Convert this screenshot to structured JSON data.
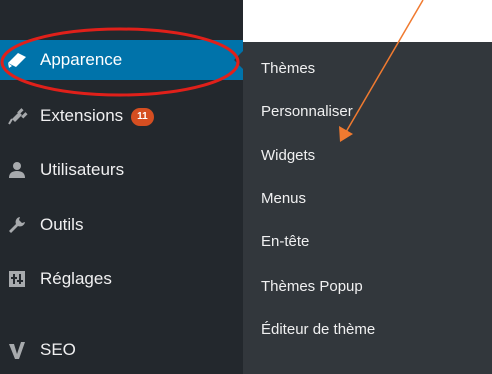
{
  "sidebar": {
    "items": [
      {
        "label": "Apparence",
        "icon": "paint-brush-icon",
        "active": true
      },
      {
        "label": "Extensions",
        "icon": "plugin-icon",
        "badge": "11"
      },
      {
        "label": "Utilisateurs",
        "icon": "users-icon"
      },
      {
        "label": "Outils",
        "icon": "wrench-icon"
      },
      {
        "label": "Réglages",
        "icon": "settings-icon"
      },
      {
        "label": "SEO",
        "icon": "seo-icon"
      }
    ]
  },
  "submenu": {
    "items": [
      {
        "label": "Thèmes"
      },
      {
        "label": "Personnaliser"
      },
      {
        "label": "Widgets"
      },
      {
        "label": "Menus"
      },
      {
        "label": "En-tête"
      },
      {
        "label": "Thèmes Popup"
      },
      {
        "label": "Éditeur de thème"
      }
    ]
  },
  "annotations": {
    "highlight": "red-ellipse-around-apparence",
    "arrow": "orange-arrow-pointing-to-widgets"
  },
  "colors": {
    "sidebar_bg": "#23282d",
    "submenu_bg": "#32373c",
    "active_bg": "#0073aa",
    "badge": "#d54e21",
    "ellipse": "#e0201a",
    "arrow": "#f07a30"
  }
}
